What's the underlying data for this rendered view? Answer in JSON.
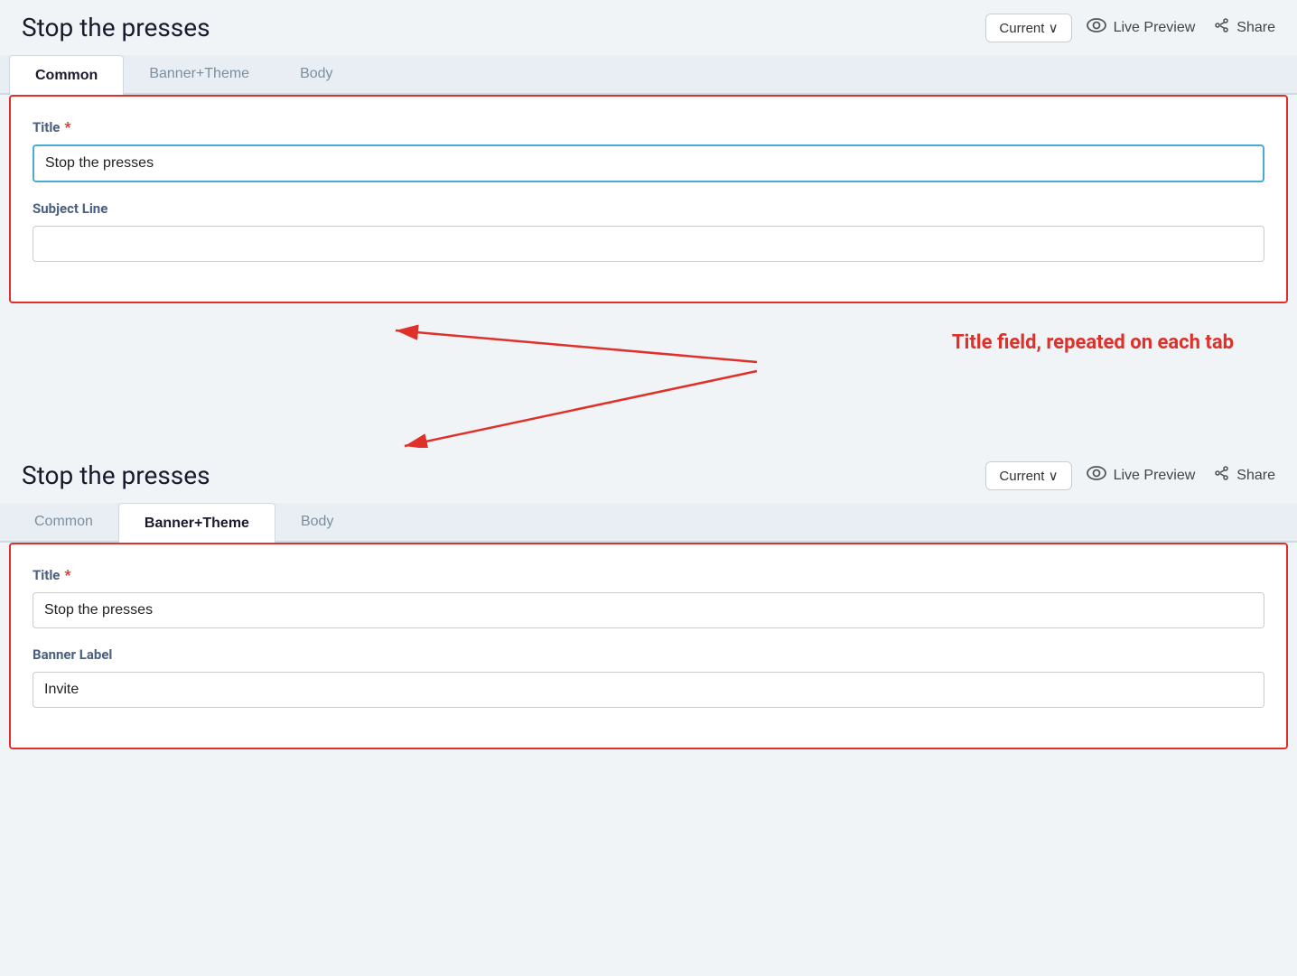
{
  "panel1": {
    "title": "Stop the presses",
    "version_button": "Current ∨",
    "live_preview": "Live Preview",
    "share": "Share",
    "tabs": [
      {
        "label": "Common",
        "active": true
      },
      {
        "label": "Banner+Theme",
        "active": false
      },
      {
        "label": "Body",
        "active": false
      }
    ],
    "fields": {
      "title_label": "Title",
      "title_value": "Stop the presses",
      "subject_line_label": "Subject Line",
      "subject_line_value": ""
    }
  },
  "annotation": {
    "text": "Title field, repeated on each tab"
  },
  "panel2": {
    "title": "Stop the presses",
    "version_button": "Current ∨",
    "live_preview": "Live Preview",
    "share": "Share",
    "tabs": [
      {
        "label": "Common",
        "active": false
      },
      {
        "label": "Banner+Theme",
        "active": true
      },
      {
        "label": "Body",
        "active": false
      }
    ],
    "fields": {
      "title_label": "Title",
      "title_value": "Stop the presses",
      "banner_label_label": "Banner Label",
      "banner_label_value": "Invite"
    }
  }
}
